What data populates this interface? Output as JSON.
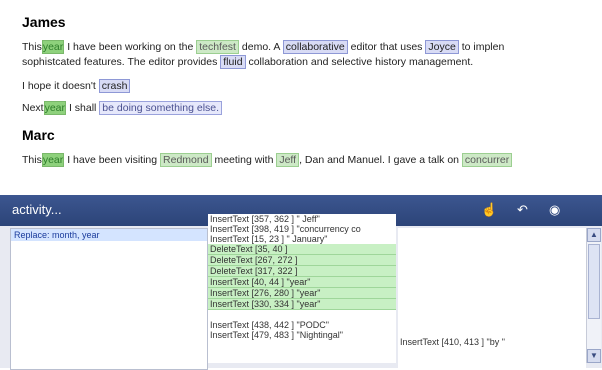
{
  "document": {
    "sections": [
      {
        "author": "James",
        "lines": [
          [
            "This",
            "year",
            " I have been working on the ",
            "techfest",
            " demo. A ",
            "collaborative",
            " editor that uses ",
            "Joyce",
            " to implen"
          ],
          [
            "sophistcated features. The editor provides ",
            "fluid",
            " collaboration and selective history management."
          ],
          [
            "I hope it doesn't ",
            "crash"
          ],
          [
            "Next",
            "year",
            " I shall ",
            "be doing something else."
          ]
        ]
      },
      {
        "author": "Marc",
        "lines": [
          [
            "This",
            "year",
            " I have been visiting ",
            "Redmond",
            " meeting with ",
            "Jeff",
            ", Dan and Manuel. I gave a talk on ",
            "concurrer"
          ]
        ]
      }
    ]
  },
  "panel": {
    "title": "activity...",
    "icons": [
      "cursor-hand-icon",
      "undo-icon",
      "eye-icon"
    ],
    "left_items": [
      "Replace: month, year"
    ],
    "mid_items": [
      {
        "text": "InsertText [357, 362 ] \" Jeff\"",
        "selected": false
      },
      {
        "text": "InsertText [398, 419 ] \"concurrency co",
        "selected": false
      },
      {
        "text": "InsertText [15, 23 ] \" January\"",
        "selected": false
      },
      {
        "text": "DeleteText [35, 40 ]",
        "selected": true
      },
      {
        "text": "DeleteText [267, 272 ]",
        "selected": true
      },
      {
        "text": "DeleteText [317, 322 ]",
        "selected": true
      },
      {
        "text": "InsertText [40, 44 ] \"year\"",
        "selected": true
      },
      {
        "text": "InsertText [276, 280 ] \"year\"",
        "selected": true
      },
      {
        "text": "InsertText [330, 334 ] \"year\"",
        "selected": true
      },
      {
        "text": "",
        "selected": false
      },
      {
        "text": "InsertText [438, 442 ] \"PODC\"",
        "selected": false
      },
      {
        "text": "InsertText [479, 483 ] \"Nightingal\"",
        "selected": false
      }
    ],
    "right_text": "InsertText [410, 413 ] \"by \""
  }
}
